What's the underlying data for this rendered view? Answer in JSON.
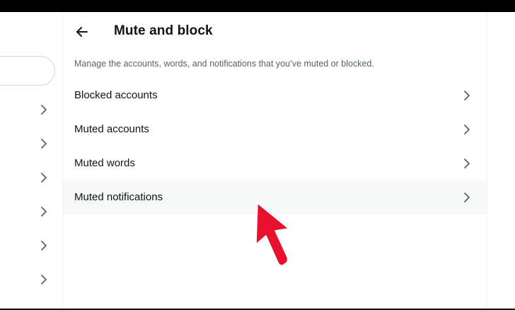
{
  "header": {
    "title": "Mute and block"
  },
  "description": "Manage the accounts, words, and notifications that you’ve muted or blocked.",
  "menu": [
    {
      "label": "Blocked accounts"
    },
    {
      "label": "Muted accounts"
    },
    {
      "label": "Muted words"
    },
    {
      "label": "Muted notifications"
    }
  ],
  "icons": {
    "back": "arrow-left-icon",
    "chevron": "chevron-right-icon",
    "annotation": "red-pointer-arrow"
  },
  "colors": {
    "text_primary": "#0f1419",
    "text_secondary": "#536471",
    "hover_background": "#f7f9f9",
    "border": "#eff3f4",
    "annotation_red": "#e8112d"
  }
}
